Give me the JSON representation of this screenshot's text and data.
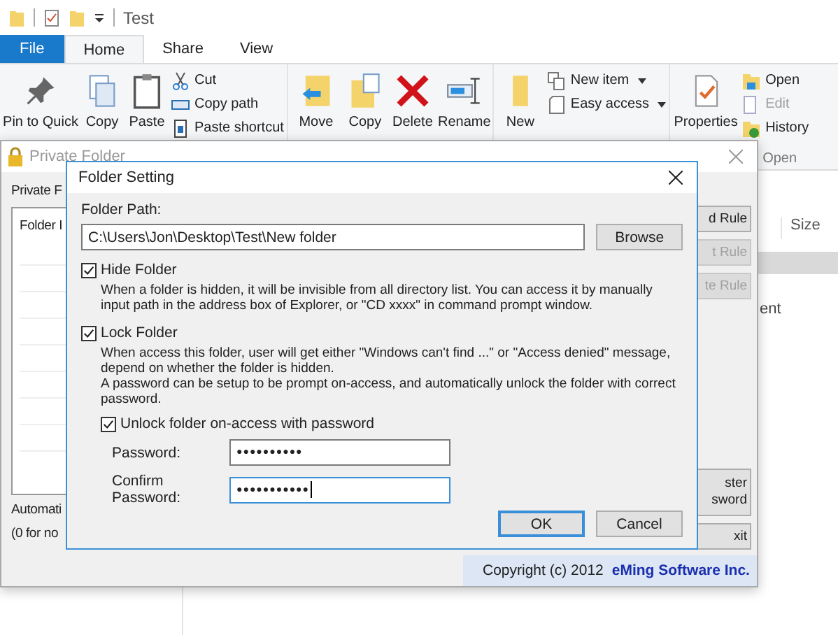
{
  "explorer": {
    "title": "Test",
    "tabs": [
      {
        "label": "File",
        "kind": "file",
        "selected": false
      },
      {
        "label": "Home",
        "kind": "tab",
        "selected": true
      },
      {
        "label": "Share",
        "kind": "tab",
        "selected": false
      },
      {
        "label": "View",
        "kind": "tab",
        "selected": false
      }
    ],
    "ribbon": {
      "clipboard": {
        "pin": "Pin to Quick",
        "copy": "Copy",
        "paste": "Paste",
        "cut": "Cut",
        "copy_path": "Copy path",
        "paste_shortcut": "Paste shortcut"
      },
      "organize": {
        "move_to": "Move",
        "copy_to": "Copy",
        "delete": "Delete",
        "rename": "Rename"
      },
      "new": {
        "new_folder": "New",
        "new_item": "New item",
        "easy_access": "Easy access"
      },
      "open": {
        "properties": "Properties",
        "open": "Open",
        "edit": {
          "label": "Edit",
          "disabled": true
        },
        "history": "History",
        "group_label": "Open"
      }
    },
    "file_list": {
      "column_header": "Size",
      "row_text": "ent"
    }
  },
  "private_folder": {
    "title": "Private Folder",
    "list_label": "Private F",
    "list_header": "Folder I",
    "rule_buttons": [
      {
        "label": "d Rule",
        "disabled": false
      },
      {
        "label": "t Rule",
        "disabled": true
      },
      {
        "label": "te Rule",
        "disabled": true
      }
    ],
    "password_button": [
      "ster",
      "sword"
    ],
    "exit_button": "xit",
    "auto_lines": [
      "Automati",
      "(0 for no"
    ],
    "copyright": "Copyright (c) 2012",
    "company": "eMing Software Inc."
  },
  "dialog": {
    "title": "Folder Setting",
    "path_label": "Folder Path:",
    "path": "C:\\Users\\Jon\\Desktop\\Test\\New folder",
    "browse": "Browse",
    "options": [
      {
        "label": "Hide Folder",
        "checked": true,
        "description": [
          "When a folder is hidden, it will be invisible from all directory list. You can access it by manually input path in the address box of Explorer, or \"CD xxxx\" in command prompt window."
        ]
      },
      {
        "label": "Lock Folder",
        "checked": true,
        "description": [
          "When access this folder, user will get either \"Windows can't find ...\" or \"Access denied\" message, depend on whether the folder is hidden.",
          "A password can be setup to be prompt on-access, and automatically unlock the folder with correct password."
        ]
      }
    ],
    "unlock": {
      "label": "Unlock folder on-access with password",
      "checked": true
    },
    "fields": [
      {
        "label": "Password:",
        "value": "●●●●●●●●●●",
        "focused": false
      },
      {
        "label": "Confirm Password:",
        "value": "●●●●●●●●●●●",
        "focused": true
      }
    ],
    "buttons": [
      {
        "label": "OK",
        "default": true
      },
      {
        "label": "Cancel",
        "default": false
      }
    ]
  }
}
